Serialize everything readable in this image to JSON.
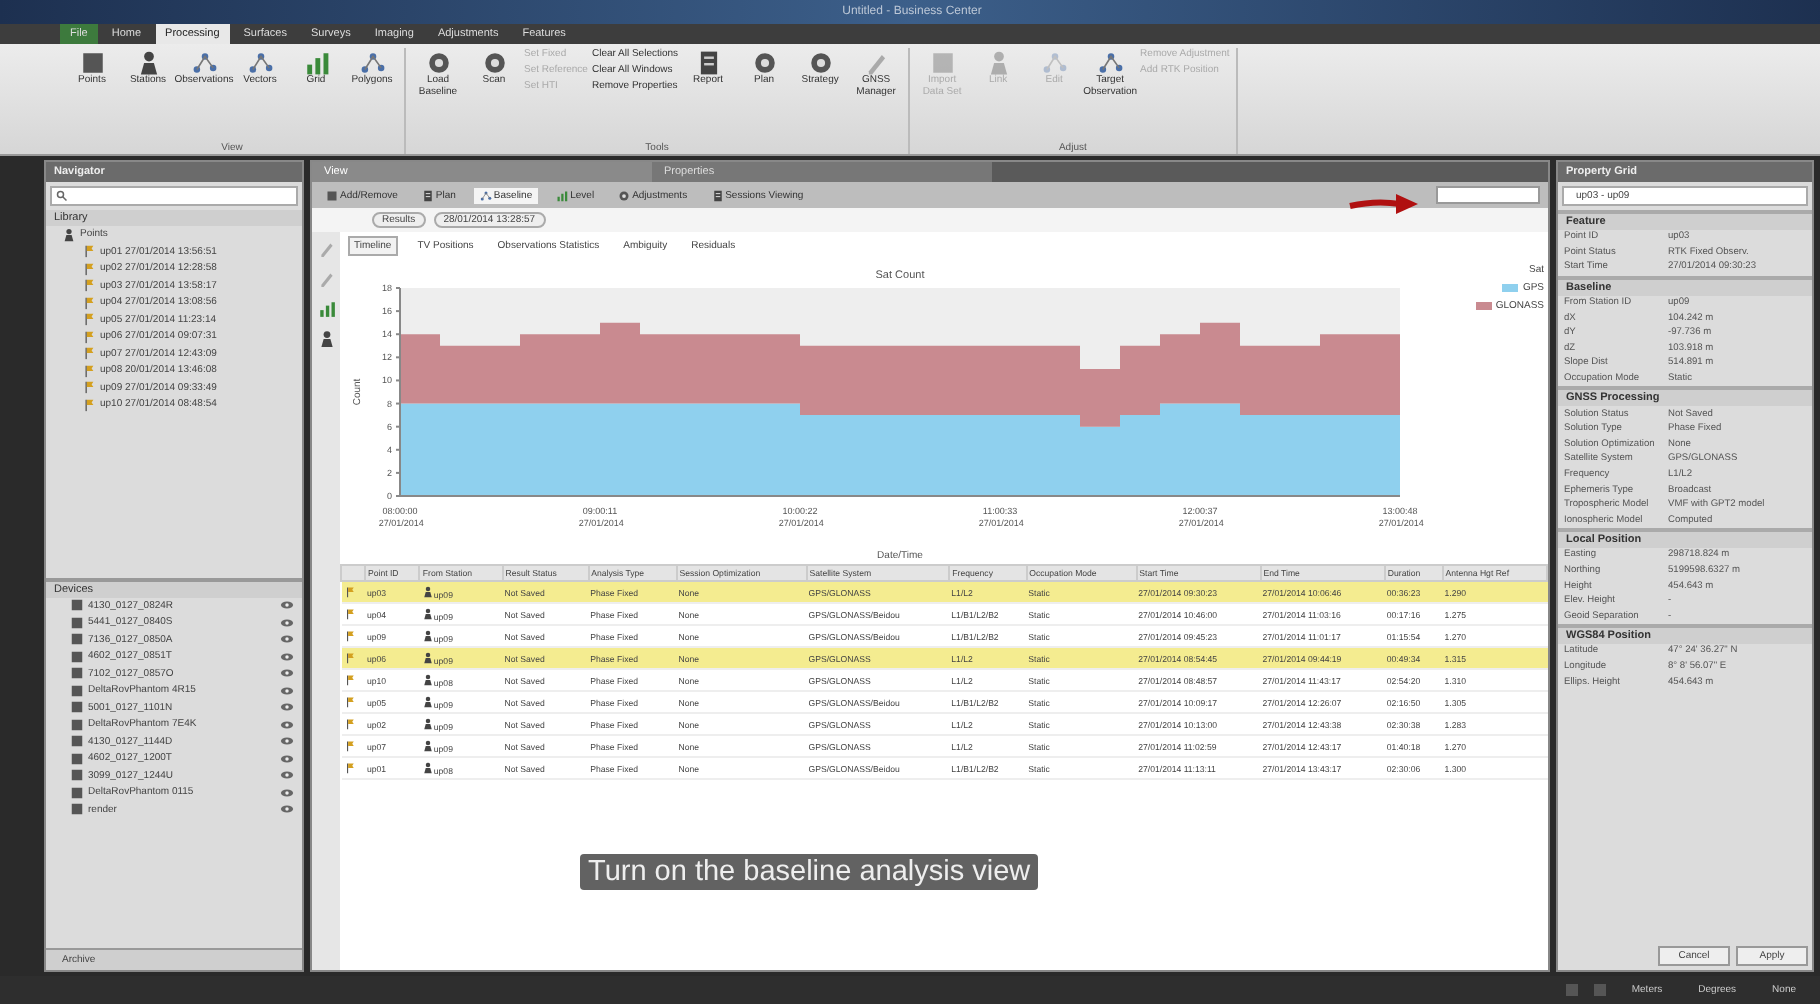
{
  "window": {
    "title": "Untitled - Business Center"
  },
  "menu_tabs": [
    {
      "label": "File",
      "selected": false
    },
    {
      "label": "Home",
      "selected": false
    },
    {
      "label": "Processing",
      "selected": true
    },
    {
      "label": "Surfaces",
      "selected": false
    },
    {
      "label": "Surveys",
      "selected": false
    },
    {
      "label": "Imaging",
      "selected": false
    },
    {
      "label": "Adjustments",
      "selected": false
    },
    {
      "label": "Features",
      "selected": false
    }
  ],
  "ribbon": {
    "groups": [
      {
        "label": "View",
        "large": [
          {
            "label": "Points",
            "disabled": false
          },
          {
            "label": "Stations",
            "disabled": false
          },
          {
            "label": "Observations",
            "disabled": false
          },
          {
            "label": "Vectors",
            "disabled": false
          },
          {
            "label": "Grid",
            "disabled": false
          },
          {
            "label": "Polygons",
            "disabled": false
          }
        ]
      },
      {
        "label": "Tools",
        "large": [
          {
            "label": "Load Baseline",
            "disabled": false
          },
          {
            "label": "Scan",
            "disabled": false
          }
        ],
        "small": [
          {
            "label": "Set Fixed",
            "disabled": true
          },
          {
            "label": "Set Reference",
            "disabled": true
          },
          {
            "label": "Set HTI",
            "disabled": true
          },
          {
            "label": "Clear All Selections",
            "disabled": false
          },
          {
            "label": "Clear All Windows",
            "disabled": false
          },
          {
            "label": "Remove Properties",
            "disabled": false
          }
        ],
        "more": [
          {
            "label": "Report",
            "disabled": false
          },
          {
            "label": "Plan",
            "disabled": false
          },
          {
            "label": "Strategy",
            "disabled": false
          },
          {
            "label": "GNSS Manager",
            "disabled": false
          }
        ]
      },
      {
        "label": "Adjust",
        "large": [
          {
            "label": "Import Data Set",
            "disabled": true
          },
          {
            "label": "Link",
            "disabled": true
          },
          {
            "label": "Edit",
            "disabled": true
          },
          {
            "label": "Target Observation",
            "disabled": false
          }
        ],
        "small": [
          {
            "label": "Remove Adjustment",
            "disabled": true
          },
          {
            "label": "Add RTK Position",
            "disabled": true
          }
        ]
      }
    ]
  },
  "navigator": {
    "title": "Navigator",
    "library": {
      "title": "Library",
      "root": "Points",
      "items": [
        "up01 27/01/2014 13:56:51",
        "up02 27/01/2014 12:28:58",
        "up03 27/01/2014 13:58:17",
        "up04 27/01/2014 13:08:56",
        "up05 27/01/2014 11:23:14",
        "up06 27/01/2014 09:07:31",
        "up07 27/01/2014 12:43:09",
        "up08 20/01/2014 13:46:08",
        "up09 27/01/2014 09:33:49",
        "up10 27/01/2014 08:48:54"
      ]
    },
    "devices": {
      "title": "Devices",
      "items": [
        "4130_0127_0824R",
        "5441_0127_0840S",
        "7136_0127_0850A",
        "4602_0127_0851T",
        "7102_0127_0857O",
        "DeltaRovPhantom 4R15",
        "5001_0127_1101N",
        "DeltaRovPhantom 7E4K",
        "4130_0127_1144D",
        "4602_0127_1200T",
        "3099_0127_1244U",
        "DeltaRovPhantom 0115",
        "render"
      ]
    },
    "footer": "Archive"
  },
  "view": {
    "pane_tabs": [
      {
        "label": "View",
        "selected": true
      },
      {
        "label": "Properties",
        "selected": false
      }
    ],
    "toolbar_tabs": [
      {
        "label": "Add/Remove",
        "selected": false
      },
      {
        "label": "Plan",
        "selected": false
      },
      {
        "label": "Baseline",
        "selected": true
      },
      {
        "label": "Level",
        "selected": false
      },
      {
        "label": "Adjustments",
        "selected": false
      },
      {
        "label": "Sessions Viewing",
        "selected": false
      }
    ],
    "breadcrumb": [
      "Results",
      "28/01/2014 13:28:57"
    ],
    "sub_tabs": [
      {
        "label": "Timeline",
        "selected": true
      },
      {
        "label": "TV Positions",
        "selected": false
      },
      {
        "label": "Observations Statistics",
        "selected": false
      },
      {
        "label": "Ambiguity",
        "selected": false
      },
      {
        "label": "Residuals",
        "selected": false
      }
    ],
    "chart_data": {
      "type": "area",
      "stacked": true,
      "title": "Sat Count",
      "xlabel": "Date/Time",
      "ylabel": "Count",
      "legend_title": "Sat",
      "categories": [
        "08:00:00 27/01/2014",
        null,
        null,
        null,
        null,
        "09:00:11 27/01/2014",
        null,
        null,
        null,
        null,
        "10:00:22 27/01/2014",
        null,
        null,
        null,
        null,
        "11:00:33 27/01/2014",
        null,
        null,
        null,
        null,
        "12:00:37 27/01/2014",
        null,
        null,
        null,
        null,
        "13:00:48 27/01/2014"
      ],
      "series": [
        {
          "name": "GPS",
          "color": "#8fd0ee",
          "values": [
            8,
            8,
            8,
            8,
            8,
            8,
            8,
            8,
            8,
            8,
            7,
            7,
            7,
            7,
            7,
            7,
            7,
            6,
            7,
            8,
            8,
            7,
            7,
            7,
            7,
            7
          ]
        },
        {
          "name": "GLONASS",
          "color": "#c98a90",
          "values": [
            6,
            5,
            5,
            6,
            6,
            7,
            6,
            6,
            6,
            6,
            6,
            6,
            6,
            6,
            6,
            6,
            6,
            5,
            6,
            6,
            7,
            6,
            6,
            7,
            7,
            7
          ]
        }
      ],
      "ylim": [
        0,
        18
      ],
      "yticks": [
        0,
        2,
        4,
        6,
        8,
        10,
        12,
        14,
        16,
        18
      ]
    },
    "table": {
      "columns": [
        "Point ID",
        "From Station",
        "Result Status",
        "Analysis Type",
        "Session Optimization",
        "Satellite System",
        "Frequency",
        "Occupation Mode",
        "Start Time",
        "End Time",
        "Duration",
        "Antenna Hgt Ref"
      ],
      "rows": [
        {
          "selected": true,
          "cells": [
            "up03",
            "up09",
            "Not Saved",
            "Phase Fixed",
            "None",
            "GPS/GLONASS",
            "L1/L2",
            "Static",
            "27/01/2014 09:30:23",
            "27/01/2014 10:06:46",
            "00:36:23",
            "1.290"
          ]
        },
        {
          "selected": false,
          "cells": [
            "up04",
            "up09",
            "Not Saved",
            "Phase Fixed",
            "None",
            "GPS/GLONASS/Beidou",
            "L1/B1/L2/B2",
            "Static",
            "27/01/2014 10:46:00",
            "27/01/2014 11:03:16",
            "00:17:16",
            "1.275"
          ]
        },
        {
          "selected": false,
          "cells": [
            "up09",
            "up09",
            "Not Saved",
            "Phase Fixed",
            "None",
            "GPS/GLONASS/Beidou",
            "L1/B1/L2/B2",
            "Static",
            "27/01/2014 09:45:23",
            "27/01/2014 11:01:17",
            "01:15:54",
            "1.270"
          ]
        },
        {
          "selected": true,
          "cells": [
            "up06",
            "up09",
            "Not Saved",
            "Phase Fixed",
            "None",
            "GPS/GLONASS",
            "L1/L2",
            "Static",
            "27/01/2014 08:54:45",
            "27/01/2014 09:44:19",
            "00:49:34",
            "1.315"
          ]
        },
        {
          "selected": false,
          "cells": [
            "up10",
            "up08",
            "Not Saved",
            "Phase Fixed",
            "None",
            "GPS/GLONASS",
            "L1/L2",
            "Static",
            "27/01/2014 08:48:57",
            "27/01/2014 11:43:17",
            "02:54:20",
            "1.310"
          ]
        },
        {
          "selected": false,
          "cells": [
            "up05",
            "up09",
            "Not Saved",
            "Phase Fixed",
            "None",
            "GPS/GLONASS/Beidou",
            "L1/B1/L2/B2",
            "Static",
            "27/01/2014 10:09:17",
            "27/01/2014 12:26:07",
            "02:16:50",
            "1.305"
          ]
        },
        {
          "selected": false,
          "cells": [
            "up02",
            "up09",
            "Not Saved",
            "Phase Fixed",
            "None",
            "GPS/GLONASS",
            "L1/L2",
            "Static",
            "27/01/2014 10:13:00",
            "27/01/2014 12:43:38",
            "02:30:38",
            "1.283"
          ]
        },
        {
          "selected": false,
          "cells": [
            "up07",
            "up09",
            "Not Saved",
            "Phase Fixed",
            "None",
            "GPS/GLONASS",
            "L1/L2",
            "Static",
            "27/01/2014 11:02:59",
            "27/01/2014 12:43:17",
            "01:40:18",
            "1.270"
          ]
        },
        {
          "selected": false,
          "cells": [
            "up01",
            "up08",
            "Not Saved",
            "Phase Fixed",
            "None",
            "GPS/GLONASS/Beidou",
            "L1/B1/L2/B2",
            "Static",
            "27/01/2014 11:13:11",
            "27/01/2014 13:43:17",
            "02:30:06",
            "1.300"
          ]
        }
      ]
    },
    "caption": "Turn on the baseline analysis view"
  },
  "property_grid": {
    "title": "Property Grid",
    "selector": "up03 - up09",
    "sections": [
      {
        "title": "Feature",
        "rows": [
          [
            "Point ID",
            "up03"
          ],
          [
            "Point Status",
            "RTK Fixed Observ."
          ],
          [
            "Start Time",
            "27/01/2014 09:30:23"
          ]
        ]
      },
      {
        "title": "Baseline",
        "rows": [
          [
            "From Station ID",
            "up09"
          ],
          [
            "dX",
            "104.242 m"
          ],
          [
            "dY",
            "-97.736 m"
          ],
          [
            "dZ",
            "103.918 m"
          ],
          [
            "Slope Dist",
            "514.891 m"
          ],
          [
            "Occupation Mode",
            "Static"
          ]
        ]
      },
      {
        "title": "GNSS Processing",
        "rows": [
          [
            "Solution Status",
            "Not Saved"
          ],
          [
            "Solution Type",
            "Phase Fixed"
          ],
          [
            "Solution Optimization",
            "None"
          ],
          [
            "Satellite System",
            "GPS/GLONASS"
          ],
          [
            "Frequency",
            "L1/L2"
          ],
          [
            "Ephemeris Type",
            "Broadcast"
          ],
          [
            "Tropospheric Model",
            "VMF with GPT2 model"
          ],
          [
            "Ionospheric Model",
            "Computed"
          ]
        ]
      },
      {
        "title": "Local Position",
        "rows": [
          [
            "Easting",
            "298718.824 m"
          ],
          [
            "Northing",
            "5199598.6327 m"
          ],
          [
            "Height",
            "454.643 m"
          ],
          [
            "Elev. Height",
            "-"
          ],
          [
            "Geoid Separation",
            "-"
          ]
        ]
      },
      {
        "title": "WGS84 Position",
        "rows": [
          [
            "Latitude",
            "47° 24' 36.27\" N"
          ],
          [
            "Longitude",
            "8° 8' 56.07\" E"
          ],
          [
            "Ellips. Height",
            "454.643 m"
          ]
        ]
      }
    ],
    "buttons": [
      "Cancel",
      "Apply"
    ]
  },
  "status_bar": {
    "units": [
      "Meters",
      "Degrees",
      "None"
    ]
  }
}
